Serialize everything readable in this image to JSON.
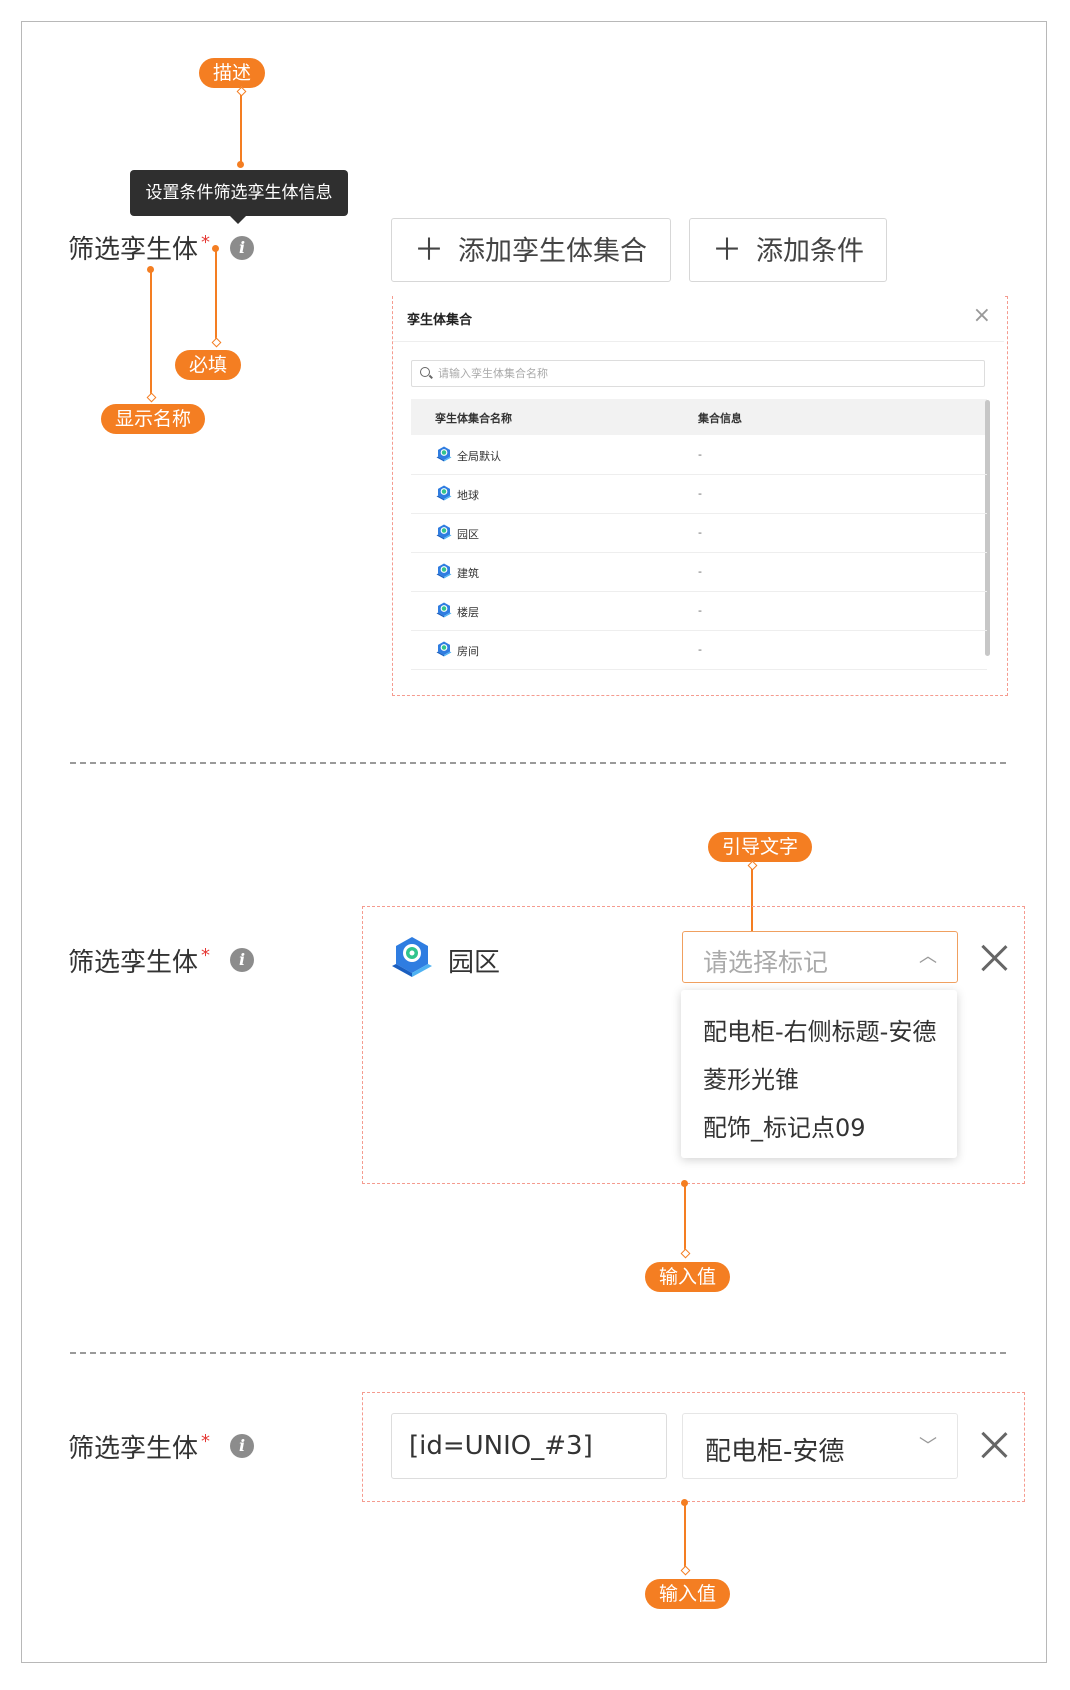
{
  "annotations": {
    "description": "描述",
    "required": "必填",
    "display_name": "显示名称",
    "guide_text": "引导文字",
    "input_value_1": "输入值",
    "input_value_2": "输入值"
  },
  "colors": {
    "accent": "#f47e22",
    "required_star": "#e53935",
    "dashed_border": "#f59b8f"
  },
  "section1": {
    "label": "筛选孪生体",
    "required_mark": "*",
    "info_icon": "i",
    "tooltip": "设置条件筛选孪生体信息",
    "add_collection_button": "添加孪生体集合",
    "add_condition_button": "添加条件",
    "plus_glyph": "＋",
    "modal": {
      "title": "孪生体集合",
      "close_glyph": "×",
      "search_placeholder": "请输入孪生体集合名称",
      "columns": [
        "孪生体集合名称",
        "集合信息"
      ],
      "rows": [
        {
          "name": "全局默认",
          "info": "-"
        },
        {
          "name": "地球",
          "info": "-"
        },
        {
          "name": "园区",
          "info": "-"
        },
        {
          "name": "建筑",
          "info": "-"
        },
        {
          "name": "楼层",
          "info": "-"
        },
        {
          "name": "房间",
          "info": "-"
        }
      ]
    }
  },
  "section2": {
    "label": "筛选孪生体",
    "required_mark": "*",
    "info_icon": "i",
    "entity_name": "园区",
    "select_placeholder": "请选择标记",
    "chevron_up": "︿",
    "options": [
      "配电柜-右侧标题-安德",
      "菱形光锥",
      "配饰_标记点09"
    ]
  },
  "section3": {
    "label": "筛选孪生体",
    "required_mark": "*",
    "info_icon": "i",
    "input_value": "[id=UNIO_#3]",
    "select_value": "配电柜-安德",
    "chevron_down": "﹀"
  }
}
